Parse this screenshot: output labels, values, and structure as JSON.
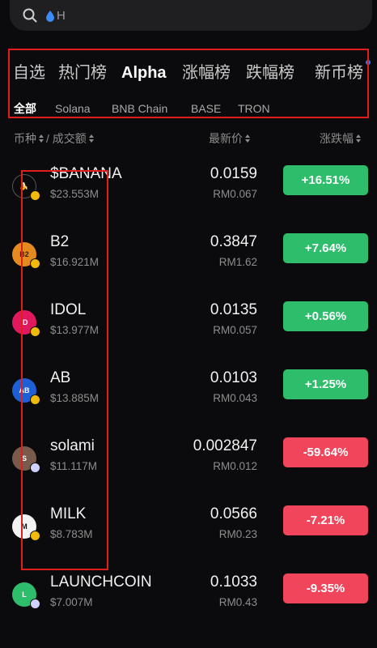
{
  "search": {
    "text": "H"
  },
  "category_tabs": [
    {
      "label": "自选"
    },
    {
      "label": "热门榜"
    },
    {
      "label": "Alpha"
    },
    {
      "label": "涨幅榜"
    },
    {
      "label": "跌幅榜"
    },
    {
      "label": "新币榜"
    }
  ],
  "chain_tabs": [
    {
      "label": "全部"
    },
    {
      "label": "Solana"
    },
    {
      "label": "BNB Chain"
    },
    {
      "label": "BASE"
    },
    {
      "label": "TRON"
    }
  ],
  "columns": {
    "coin_volume": "币种 ⬍ / 成交额",
    "coin": "币种",
    "volume": "/ 成交额",
    "price": "最新价",
    "change": "涨跌幅"
  },
  "colors": {
    "up": "#2ebd6b",
    "down": "#f0455a",
    "highlight": "#e01e1e",
    "accent_dot": "#2f7bf6"
  },
  "rows": [
    {
      "symbol": "$BANANA",
      "volume": "$23.553M",
      "price": "0.0159",
      "fiat": "RM0.067",
      "change": "+16.51%",
      "direction": "up",
      "icon": "banana-coin-icon",
      "chain": "bnb"
    },
    {
      "symbol": "B2",
      "volume": "$16.921M",
      "price": "0.3847",
      "fiat": "RM1.62",
      "change": "+7.64%",
      "direction": "up",
      "icon": "b2-coin-icon",
      "chain": "bnb"
    },
    {
      "symbol": "IDOL",
      "volume": "$13.977M",
      "price": "0.0135",
      "fiat": "RM0.057",
      "change": "+0.56%",
      "direction": "up",
      "icon": "idol-coin-icon",
      "chain": "bnb"
    },
    {
      "symbol": "AB",
      "volume": "$13.885M",
      "price": "0.0103",
      "fiat": "RM0.043",
      "change": "+1.25%",
      "direction": "up",
      "icon": "ab-coin-icon",
      "chain": "bnb"
    },
    {
      "symbol": "solami",
      "volume": "$11.117M",
      "price": "0.002847",
      "fiat": "RM0.012",
      "change": "-59.64%",
      "direction": "down",
      "icon": "solami-coin-icon",
      "chain": "sol"
    },
    {
      "symbol": "MILK",
      "volume": "$8.783M",
      "price": "0.0566",
      "fiat": "RM0.23",
      "change": "-7.21%",
      "direction": "down",
      "icon": "milk-coin-icon",
      "chain": "bnb"
    },
    {
      "symbol": "LAUNCHCOIN",
      "volume": "$7.007M",
      "price": "0.1033",
      "fiat": "RM0.43",
      "change": "-9.35%",
      "direction": "down",
      "icon": "launchcoin-coin-icon",
      "chain": "sol"
    }
  ]
}
